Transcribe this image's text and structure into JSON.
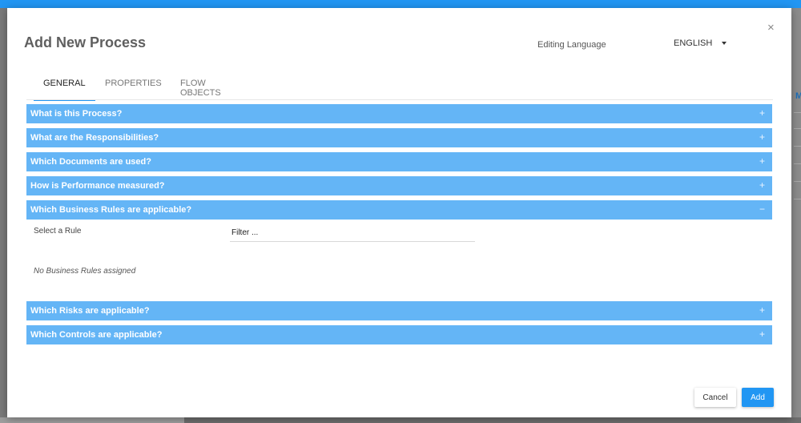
{
  "dialog": {
    "title": "Add New Process",
    "close_glyph": "×",
    "editing_language_label": "Editing Language",
    "language_value": "ENGLISH"
  },
  "tabs": [
    {
      "label": "GENERAL",
      "active": true
    },
    {
      "label": "PROPERTIES",
      "active": false
    },
    {
      "label": "FLOW OBJECTS",
      "active": false
    }
  ],
  "panels": [
    {
      "title": "What is this Process?",
      "toggle": "+"
    },
    {
      "title": "What are the Responsibilities?",
      "toggle": "+"
    },
    {
      "title": "Which Documents are used?",
      "toggle": "+"
    },
    {
      "title": "How is Performance measured?",
      "toggle": "+"
    },
    {
      "title": "Which Business Rules are applicable?",
      "toggle": "−",
      "expanded": true
    },
    {
      "title": "Which Risks are applicable?",
      "toggle": "+"
    },
    {
      "title": "Which Controls are applicable?",
      "toggle": "+"
    }
  ],
  "business_rules": {
    "select_label": "Select a Rule",
    "filter_placeholder": "Filter ...",
    "empty_message": "No Business Rules assigned"
  },
  "footer": {
    "cancel_label": "Cancel",
    "add_label": "Add"
  },
  "colors": {
    "accent": "#2196f3",
    "panel_header": "#64b5f6"
  },
  "icons": {
    "close": "close-icon",
    "dropdown": "caret-down-icon"
  }
}
